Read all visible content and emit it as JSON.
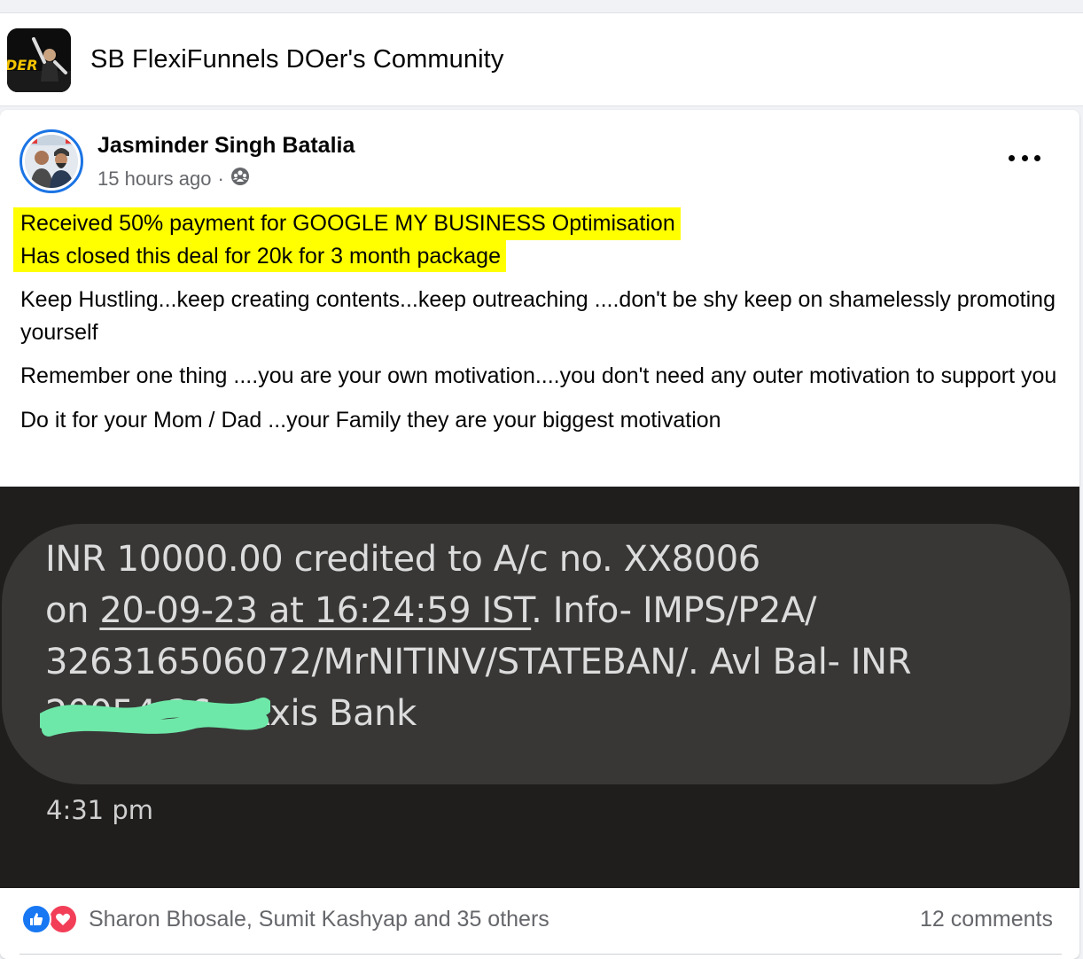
{
  "group": {
    "name": "SB FlexiFunnels DOer's Community",
    "logo_text": "DER"
  },
  "post": {
    "author": "Jasminder Singh Batalia",
    "time": "15 hours ago",
    "separator": "·",
    "audience_icon": "group-audience-icon",
    "highlighted_lines": [
      "Received 50% payment for GOOGLE MY BUSINESS Optimisation",
      "Has closed this deal for 20k for 3 month package"
    ],
    "paragraphs": [
      "Keep Hustling...keep creating contents...keep outreaching ....don't be shy keep on shamelessly promoting yourself",
      "Remember one thing ....you are your own motivation....you don't need any outer motivation to support you",
      "Do it for your Mom / Dad ...your Family they are your biggest motivation"
    ]
  },
  "sms": {
    "line1": "INR 10000.00 credited to A/c no. XX8006",
    "line2_prefix": "on ",
    "line2_underlined": "20-09-23 at 16:24:59 IST",
    "line2_suffix": ". Info- IMPS/P2A/",
    "line3": "326316506072/MrNITINV/STATEBAN/. Avl Bal- INR",
    "line4": "20054.36 - Axis Bank",
    "time": "4:31 pm",
    "colors": {
      "background": "#201e1d",
      "bubble": "#383736",
      "text": "#dcdcdc",
      "redaction": "#6ee8a8"
    }
  },
  "engagement": {
    "reactors": "Sharon Bhosale, Sumit Kashyap and 35 others",
    "comments": "12 comments",
    "reaction_icons": [
      "like-icon",
      "love-icon"
    ]
  },
  "colors": {
    "highlight": "#ffff00",
    "accent": "#1b74e4",
    "secondary_text": "#65676b"
  }
}
